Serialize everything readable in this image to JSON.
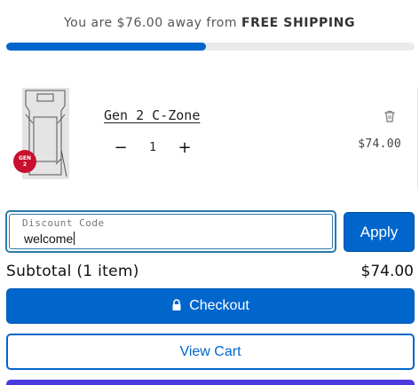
{
  "shipping": {
    "prefix": "You are $76.00 away from",
    "highlight": "FREE SHIPPING",
    "progress": 0.49
  },
  "item": {
    "title": "Gen 2 C-Zone",
    "badge": "GEN 2",
    "quantity": "1",
    "price": "$74.00",
    "minus_symbol": "−",
    "plus_symbol": "+"
  },
  "discount": {
    "label": "Discount Code",
    "value": "welcome",
    "apply_label": "Apply"
  },
  "summary": {
    "subtotal_label": "Subtotal (1 item)",
    "subtotal_value": "$74.00"
  },
  "actions": {
    "checkout_label": "Checkout",
    "view_cart_label": "View Cart"
  },
  "colors": {
    "accent": "#0066cc",
    "progress_track": "#eaeaea",
    "badge": "#c8102e",
    "bottom_button": "#4a3be0"
  },
  "icons": {
    "delete": "trash-icon",
    "checkout": "lock-icon"
  }
}
